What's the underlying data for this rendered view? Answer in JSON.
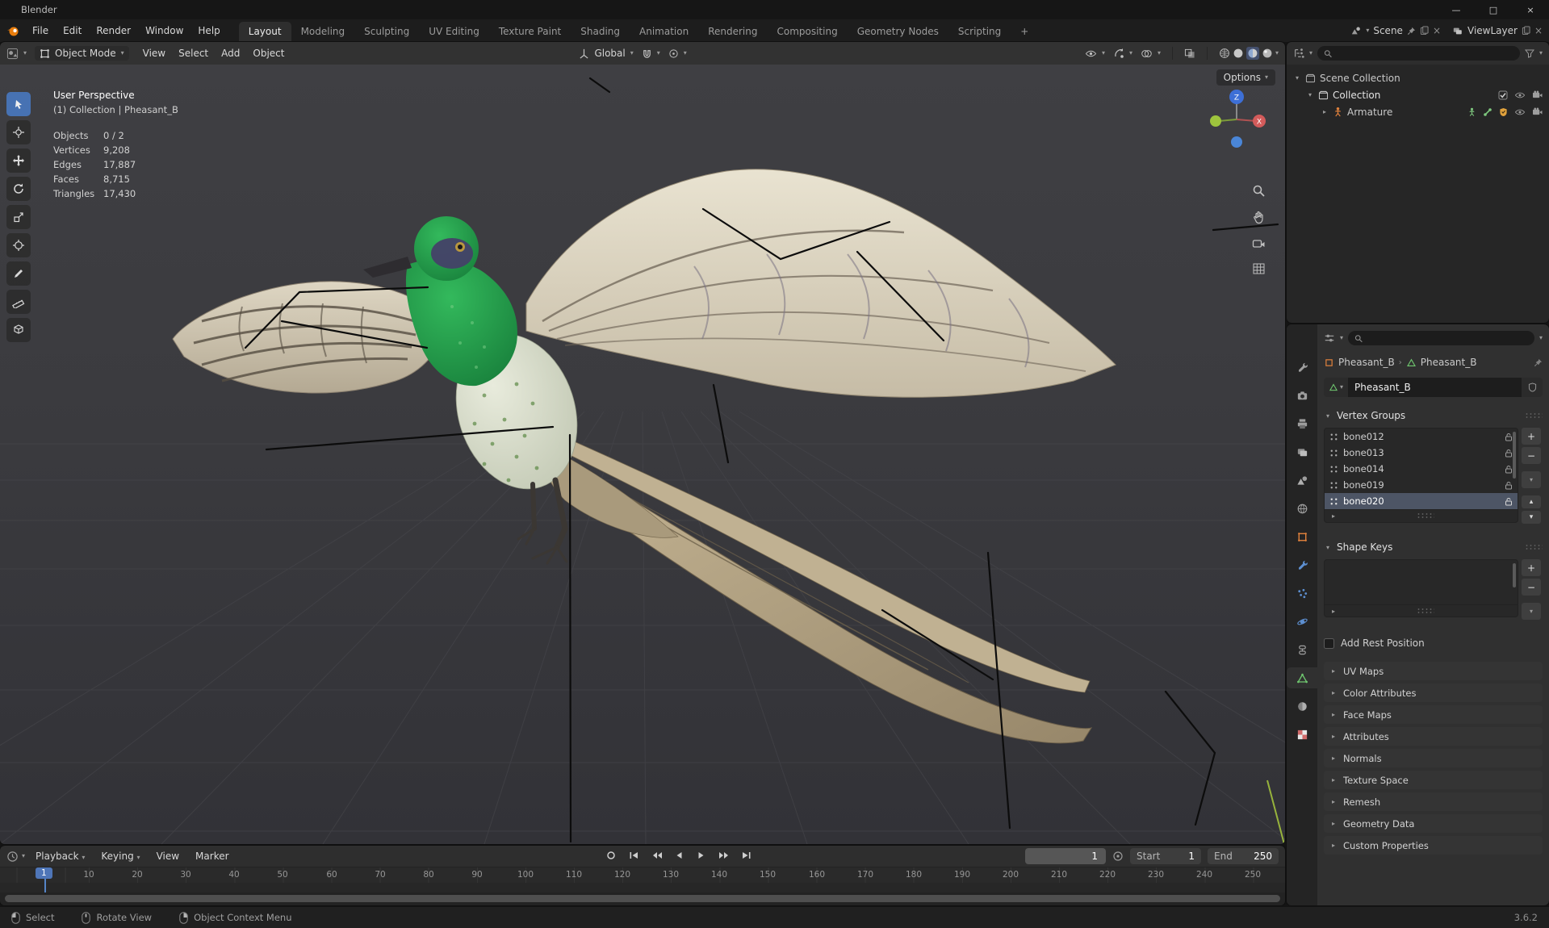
{
  "window": {
    "title": "Blender"
  },
  "topbar": {
    "menus": [
      "File",
      "Edit",
      "Render",
      "Window",
      "Help"
    ],
    "tabs": [
      "Layout",
      "Modeling",
      "Sculpting",
      "UV Editing",
      "Texture Paint",
      "Shading",
      "Animation",
      "Rendering",
      "Compositing",
      "Geometry Nodes",
      "Scripting"
    ],
    "add_tab": "+",
    "scene": "Scene",
    "view_layer": "ViewLayer"
  },
  "viewport": {
    "mode": "Object Mode",
    "menus": [
      "View",
      "Select",
      "Add",
      "Object"
    ],
    "orientation": "Global",
    "options": "Options",
    "view_name": "User Perspective",
    "context_line": "(1) Collection | Pheasant_B",
    "stats": [
      {
        "label": "Objects",
        "value": "0 / 2"
      },
      {
        "label": "Vertices",
        "value": "9,208"
      },
      {
        "label": "Edges",
        "value": "17,887"
      },
      {
        "label": "Faces",
        "value": "8,715"
      },
      {
        "label": "Triangles",
        "value": "17,430"
      }
    ],
    "gizmo": {
      "z": "Z",
      "x": "X"
    }
  },
  "timeline": {
    "menus": [
      "Playback",
      "Keying",
      "View",
      "Marker"
    ],
    "current_frame": "1",
    "marker": "1",
    "start_label": "Start",
    "start_value": "1",
    "end_label": "End",
    "end_value": "250",
    "ticks": [
      "10",
      "20",
      "30",
      "40",
      "50",
      "60",
      "70",
      "80",
      "90",
      "100",
      "110",
      "120",
      "130",
      "140",
      "150",
      "160",
      "170",
      "180",
      "190",
      "200",
      "210",
      "220",
      "230",
      "240",
      "250"
    ]
  },
  "statusbar": {
    "items": [
      "Select",
      "Rotate View",
      "Object Context Menu"
    ],
    "version": "3.6.2"
  },
  "outliner": {
    "scene_collection": "Scene Collection",
    "collection": "Collection",
    "armature": "Armature"
  },
  "properties": {
    "breadcrumb_object": "Pheasant_B",
    "breadcrumb_data": "Pheasant_B",
    "name_value": "Pheasant_B",
    "vertex_groups_title": "Vertex Groups",
    "vertex_groups": [
      "bone012",
      "bone013",
      "bone014",
      "bone019",
      "bone020"
    ],
    "selected_vertex_group": "bone020",
    "shape_keys_title": "Shape Keys",
    "add_rest_position": "Add Rest Position",
    "collapsed_panels": [
      "UV Maps",
      "Color Attributes",
      "Face Maps",
      "Attributes",
      "Normals",
      "Texture Space",
      "Remesh",
      "Geometry Data",
      "Custom Properties"
    ]
  },
  "colors": {
    "accent": "#4772b3",
    "object_orange": "#e0813c",
    "data_green": "#6fc76f",
    "axis_x_red": "#d35b5b",
    "axis_z_blue": "#3d6fd6"
  }
}
